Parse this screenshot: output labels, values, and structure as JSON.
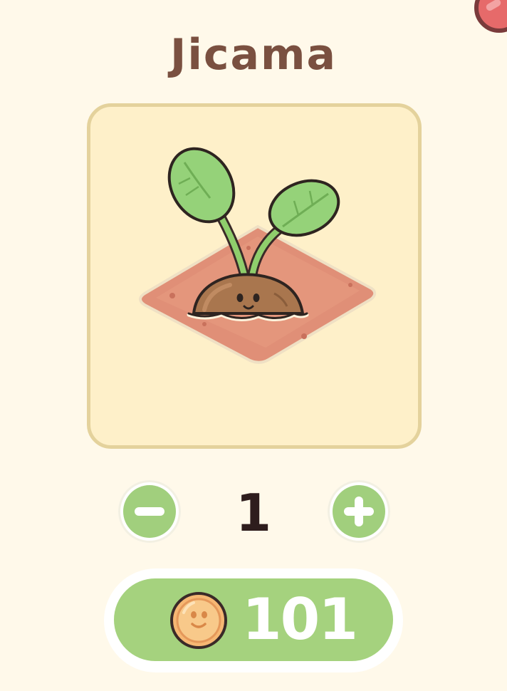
{
  "item": {
    "name": "Jicama",
    "icon": "jicama-sprout-icon"
  },
  "quantity": {
    "value": "1",
    "decrease_icon": "minus-icon",
    "increase_icon": "plus-icon"
  },
  "purchase": {
    "price": "101",
    "currency_icon": "coin-icon"
  },
  "colors": {
    "background": "#fff9ea",
    "card": "#fef0c9",
    "card_border": "#e4d29c",
    "accent_green": "#a5d27e",
    "title": "#7a5040",
    "close": "#e66a6a"
  }
}
